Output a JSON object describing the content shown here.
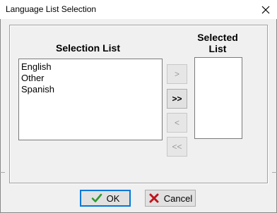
{
  "window": {
    "title": "Language List Selection"
  },
  "left_list": {
    "heading": "Selection List",
    "items": [
      "English",
      "Other",
      "Spanish"
    ]
  },
  "right_list": {
    "heading_line1": "Selected",
    "heading_line2": "List",
    "items": []
  },
  "transfer_buttons": {
    "add": {
      "label": ">",
      "enabled": false
    },
    "add_all": {
      "label": ">>",
      "enabled": true
    },
    "remove": {
      "label": "<",
      "enabled": false
    },
    "remove_all": {
      "label": "<<",
      "enabled": false
    }
  },
  "dialog_buttons": {
    "ok_label": "OK",
    "cancel_label": "Cancel"
  },
  "icons": {
    "close": "close-icon",
    "ok": "checkmark-icon",
    "cancel": "red-x-icon"
  },
  "colors": {
    "ok_check": "#2e9a2e",
    "cancel_x": "#c0141c",
    "focus_border": "#0078d7"
  }
}
